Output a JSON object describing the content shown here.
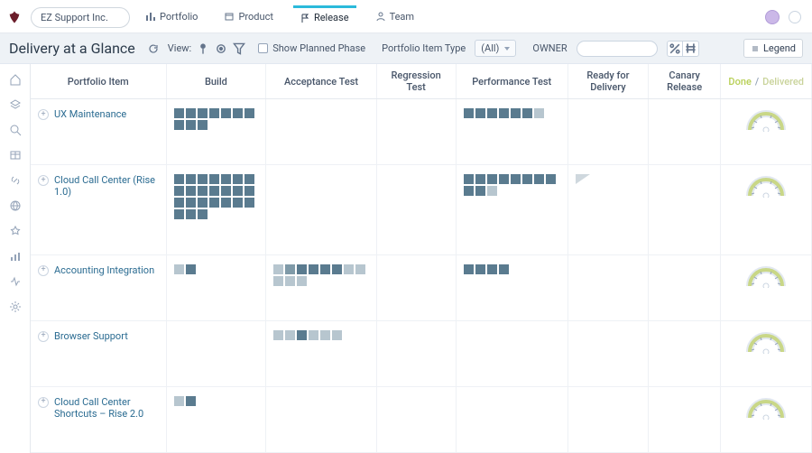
{
  "header": {
    "workspace_label": "EZ Support Inc.",
    "tabs": [
      {
        "id": "portfolio",
        "label": "Portfolio",
        "icon": "chart-bars-icon"
      },
      {
        "id": "product",
        "label": "Product",
        "icon": "box-icon"
      },
      {
        "id": "release",
        "label": "Release",
        "icon": "flag-icon",
        "active": true
      },
      {
        "id": "team",
        "label": "Team",
        "icon": "person-icon"
      }
    ]
  },
  "toolbar": {
    "title": "Delivery at a Glance",
    "view_label": "View:",
    "show_planned_label": "Show Planned Phase",
    "filter_type_label": "Portfolio Item Type",
    "filter_type_value": "(All)",
    "owner_label": "OWNER",
    "legend_label": "Legend"
  },
  "columns": {
    "portfolio_item": "Portfolio Item",
    "build": "Build",
    "acceptance": "Acceptance Test",
    "regression": "Regression Test",
    "performance": "Performance Test",
    "ready": "Ready for Delivery",
    "canary": "Canary Release",
    "done": "Done",
    "delivered": "Delivered"
  },
  "rows": [
    {
      "name": "UX Maintenance",
      "build": [
        "d",
        "d",
        "d",
        "d",
        "d",
        "d",
        "d",
        "d",
        "d",
        "d"
      ],
      "acceptance": [],
      "regression": [],
      "performance": [
        "d",
        "d",
        "d",
        "d",
        "d",
        "d",
        "l"
      ],
      "ready": [],
      "canary": []
    },
    {
      "name": "Cloud Call Center (Rise 1.0)",
      "build": [
        "d",
        "d",
        "d",
        "d",
        "d",
        "d",
        "d",
        "d",
        "d",
        "d",
        "d",
        "d",
        "d",
        "d",
        "d",
        "d",
        "d",
        "d",
        "d",
        "d",
        "d",
        "d",
        "d",
        "d"
      ],
      "acceptance": [],
      "regression": [],
      "performance": [
        "d",
        "d",
        "d",
        "d",
        "d",
        "d",
        "d",
        "d",
        "d",
        "d",
        "l"
      ],
      "ready": [
        "flag"
      ],
      "canary": []
    },
    {
      "name": "Accounting Integration",
      "build": [
        "l",
        "d"
      ],
      "acceptance": [
        "l",
        "m",
        "d",
        "d",
        "d",
        "d",
        "l",
        "l",
        "l",
        "l",
        "l"
      ],
      "regression": [],
      "performance": [
        "d",
        "d",
        "d",
        "d"
      ],
      "ready": [],
      "canary": []
    },
    {
      "name": "Browser Support",
      "build": [],
      "acceptance": [
        "l",
        "l",
        "d",
        "l",
        "l",
        "l"
      ],
      "regression": [],
      "performance": [],
      "ready": [],
      "canary": []
    },
    {
      "name": "Cloud Call Center Shortcuts – Rise 2.0",
      "build": [
        "l",
        "d"
      ],
      "acceptance": [],
      "regression": [],
      "performance": [],
      "ready": [],
      "canary": []
    }
  ],
  "side_rail": [
    "home-icon",
    "layers-icon",
    "search-icon",
    "table-icon",
    "link-icon",
    "globe-icon",
    "star-icon",
    "bars-icon",
    "activity-icon",
    "settings-icon"
  ],
  "colors": {
    "tile_dark": "#5a7b8f",
    "tile_mid": "#7f9aa8",
    "tile_light": "#b7c6cf",
    "accent": "#2bbadb",
    "gauge_band": "#c9d787"
  }
}
